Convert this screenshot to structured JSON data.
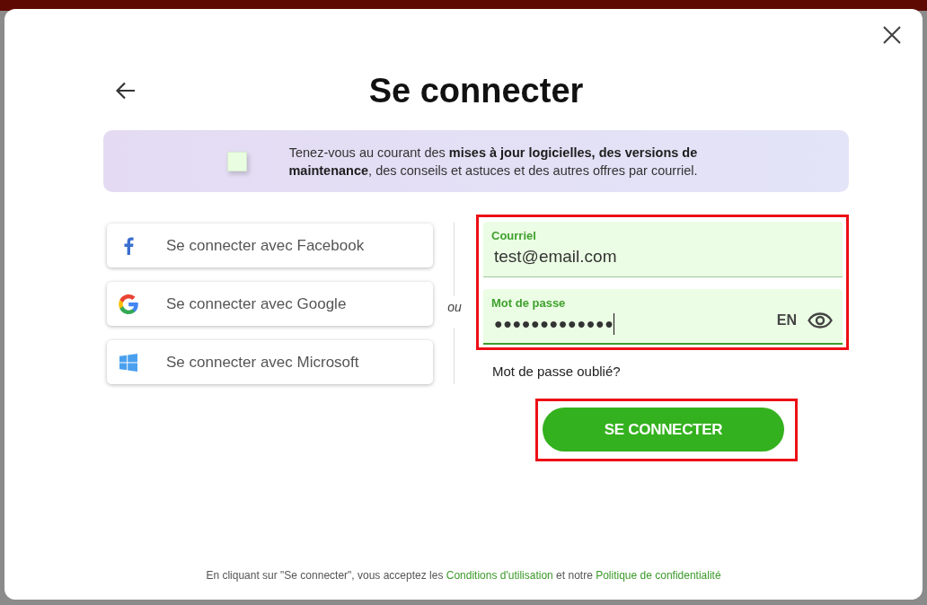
{
  "dialog": {
    "title": "Se connecter",
    "newsletter": {
      "checked": false,
      "text": "Tenez-vous au courant des **mises à jour logicielles, des versions de maintenance**, des conseils et astuces et des autres offres par courriel."
    },
    "social_buttons": [
      {
        "kind": "facebook",
        "label": "Se connecter avec Facebook"
      },
      {
        "kind": "google",
        "label": "Se connecter avec Google"
      },
      {
        "kind": "microsoft",
        "label": "Se connecter avec Microsoft"
      }
    ],
    "separator": "ou",
    "credentials": {
      "highlighted": true,
      "fields": [
        {
          "kind": "email",
          "label": "Courriel",
          "value": "test@email.com",
          "focused": false
        },
        {
          "kind": "password",
          "label": "Mot de passe",
          "value": "●●●●●●●●●●●●●",
          "focused": true,
          "keyboard_language": "EN"
        }
      ]
    },
    "forgot_password": "Mot de passe oublié?",
    "submit": {
      "label": "SE CONNECTER",
      "highlighted": true
    },
    "footer": [
      {
        "kind": "text",
        "text": "En cliquant sur \"Se connecter\", vous acceptez les"
      },
      {
        "kind": "link",
        "text": "Conditions d'utilisation"
      },
      {
        "kind": "text",
        "text": "et notre"
      },
      {
        "kind": "link",
        "text": "Politique de confidentialité"
      }
    ]
  }
}
